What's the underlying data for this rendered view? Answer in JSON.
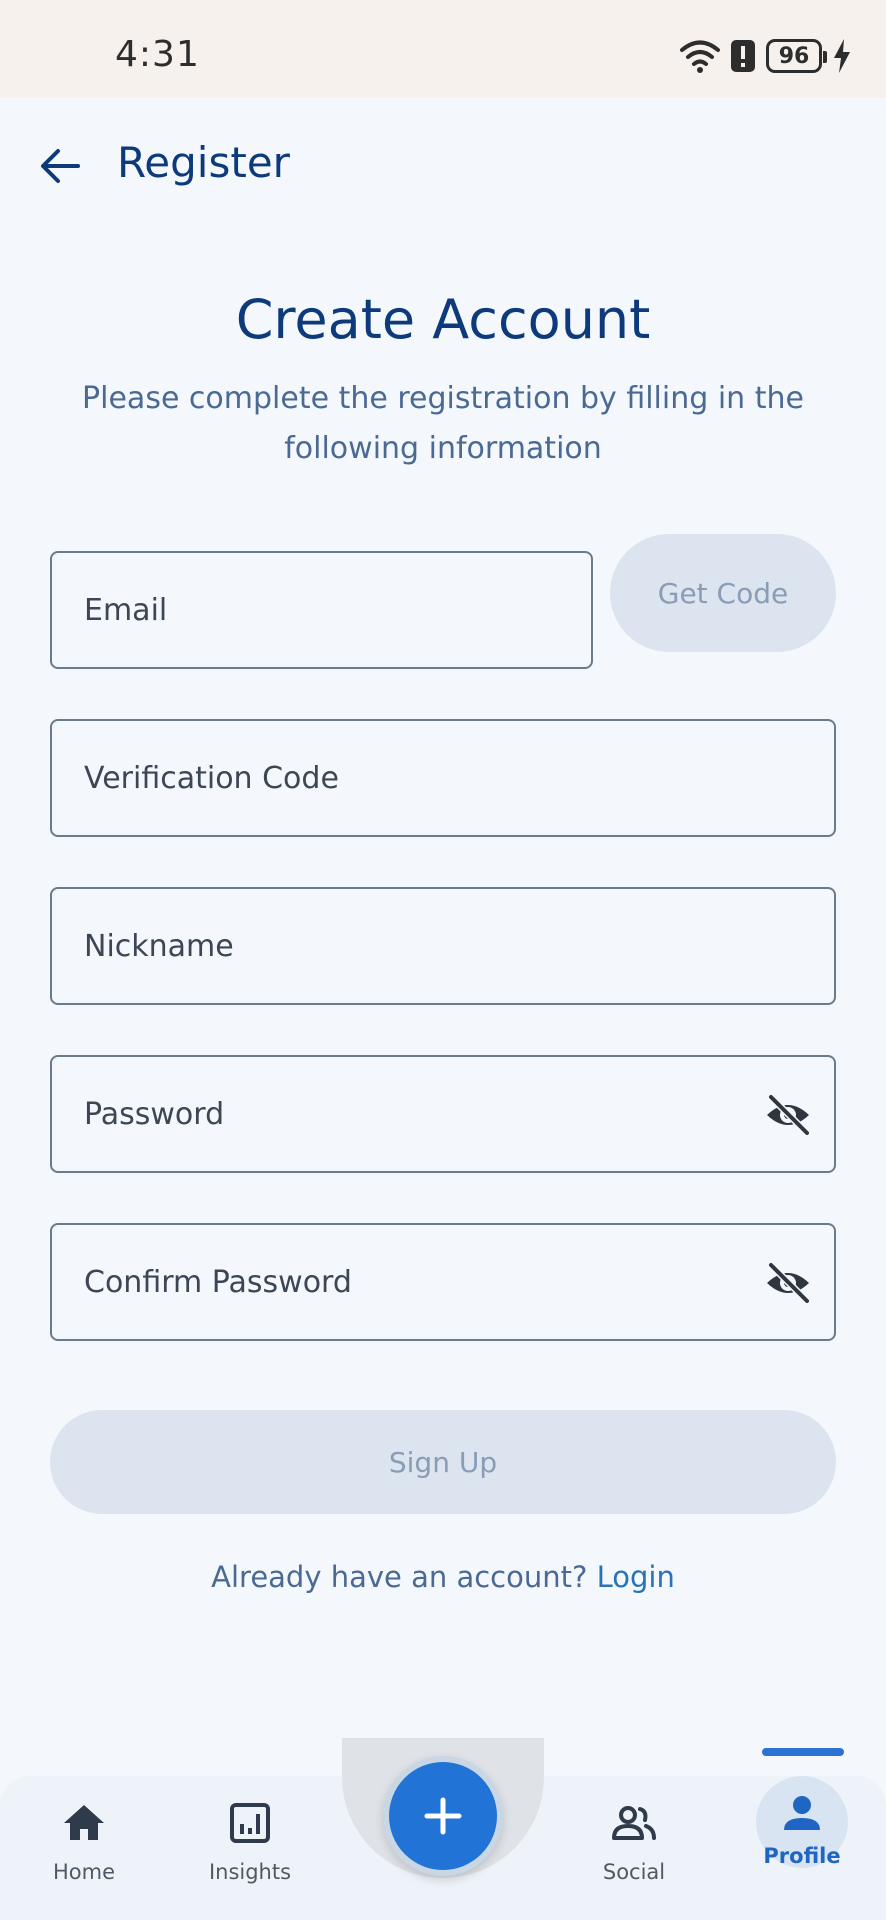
{
  "status_bar": {
    "time": "4:31",
    "battery": "96"
  },
  "app_bar": {
    "title": "Register"
  },
  "header": {
    "title": "Create Account",
    "subtitle": "Please complete the registration by filling in the following information"
  },
  "form": {
    "email_placeholder": "Email",
    "get_code_label": "Get Code",
    "verification_placeholder": "Verification Code",
    "nickname_placeholder": "Nickname",
    "password_placeholder": "Password",
    "confirm_password_placeholder": "Confirm Password",
    "signup_label": "Sign Up"
  },
  "login_prompt": {
    "text": "Already have an account?",
    "link": "Login"
  },
  "bottom_nav": {
    "items": [
      {
        "label": "Home",
        "icon": "home-icon"
      },
      {
        "label": "Insights",
        "icon": "insights-icon"
      },
      {
        "label": "Social",
        "icon": "people-icon"
      },
      {
        "label": "Profile",
        "icon": "person-icon",
        "active": true
      }
    ],
    "fab_icon": "plus-icon"
  },
  "colors": {
    "accent": "#2273d6",
    "title": "#0d3a7a",
    "disabled_button": "#dbe4ef"
  }
}
